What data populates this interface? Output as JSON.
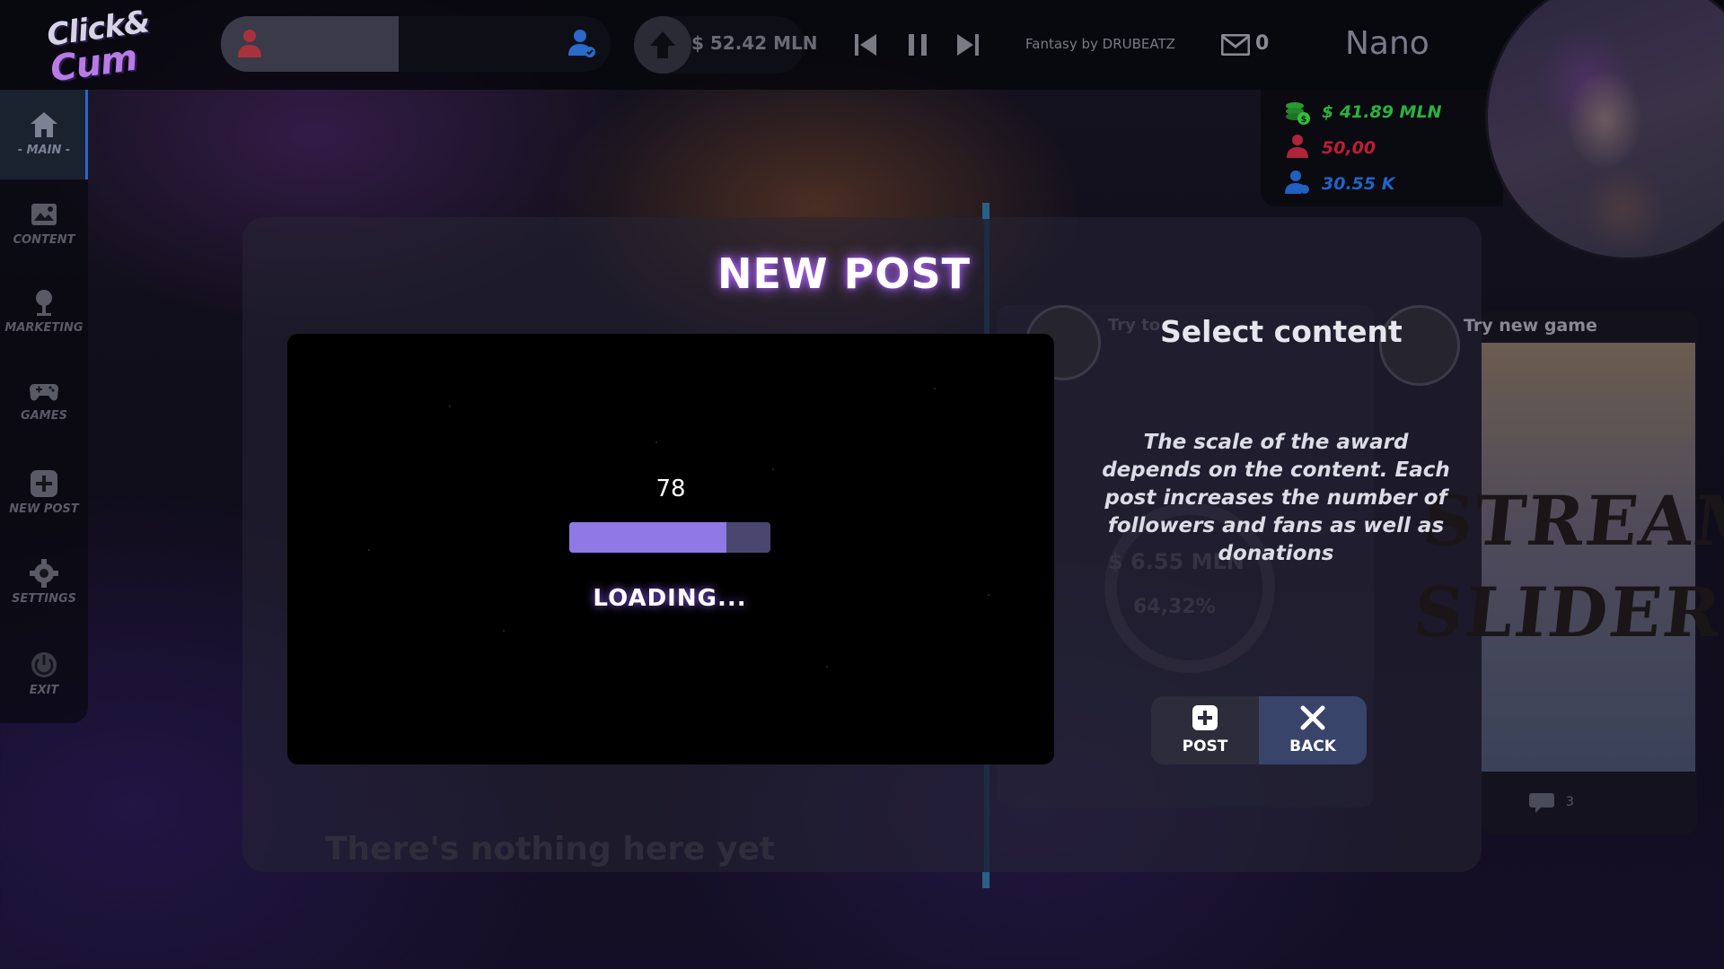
{
  "app": {
    "logo_line1": "Click&",
    "logo_line2": "Cum"
  },
  "topbar": {
    "money": "$ 52.42 MLN",
    "track": "Fantasy by DRUBEATZ",
    "mail_count": "0",
    "username": "Nano",
    "icons": {
      "fan": "fan-icon",
      "follower": "follower-icon",
      "upgrade": "up-arrow-icon",
      "prev": "skip-previous-icon",
      "pause": "pause-icon",
      "next": "skip-next-icon",
      "mail": "mail-icon"
    }
  },
  "stats": {
    "money": "$ 41.89 MLN",
    "fans": "50,00",
    "followers": "30.55 K",
    "colors": {
      "money": "#27b53c",
      "fans": "#c01c36",
      "followers": "#1f64c8"
    }
  },
  "sidebar": {
    "items": [
      {
        "label": "- MAIN -",
        "icon": "home-icon",
        "active": true
      },
      {
        "label": "CONTENT",
        "icon": "content-icon",
        "active": false
      },
      {
        "label": "MARKETING",
        "icon": "marketing-icon",
        "active": false
      },
      {
        "label": "GAMES",
        "icon": "gamepad-icon",
        "active": false
      },
      {
        "label": "NEW POST",
        "icon": "plus-icon",
        "active": false
      },
      {
        "label": "SETTINGS",
        "icon": "gear-icon",
        "active": false
      },
      {
        "label": "EXIT",
        "icon": "power-icon",
        "active": false
      }
    ]
  },
  "background": {
    "empty_text": "There's nothing here yet",
    "card_try": "Try to",
    "try_new_game": "Try new game",
    "card_money": "$ 6.55 MLN",
    "card_percent": "64,32%",
    "game_title_line1": "STREAM",
    "game_title_line2": "SLIDER",
    "game_comment_count": "3"
  },
  "dialog": {
    "title": "NEW POST",
    "progress_value": "78",
    "progress_fraction": 0.78,
    "loading_text": "LOADING...",
    "select_title": "Select content",
    "award_text": "The scale of the award depends on the content. Each post increases the number of followers and fans as well as donations",
    "post_button": "POST",
    "back_button": "BACK",
    "accent_color": "#8f79e6"
  }
}
